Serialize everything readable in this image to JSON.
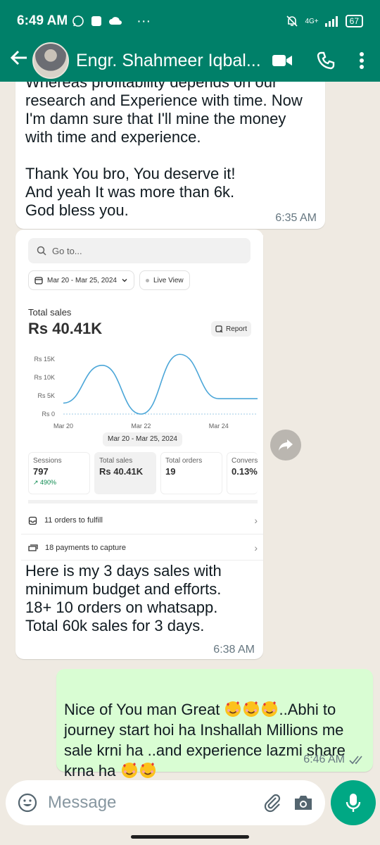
{
  "status_bar": {
    "time": "6:49 AM",
    "dots": "···",
    "network": "4G+",
    "battery": "67"
  },
  "app_bar": {
    "contact_name": "Engr. Shahmeer Iqbal...",
    "back_icon": "arrow-left-icon",
    "video_icon": "video-call-icon",
    "call_icon": "phone-icon",
    "menu_icon": "more-vert-icon"
  },
  "messages": [
    {
      "text_top_cut": "Whereas profitability depends on our",
      "text": "research and Experience with time. Now\nI'm damn sure that I'll mine the money\nwith time and experience.\n\nThank You bro, You deserve it!\nAnd yeah It was more than 6k.\nGod bless you.",
      "time": "6:35 AM"
    },
    {
      "caption": "Here is my 3 days sales with\nminimum budget and efforts.\n18+ 10 orders on whatsapp.\nTotal 60k sales for 3 days.",
      "time": "6:38 AM"
    },
    {
      "text_parts": [
        "Nice of You man Great ",
        "..Abhi to\njourney start hoi ha Inshallah Millions me\nsale krni ha ..and experience lazmi share\nkrna ha "
      ],
      "time": "6:46 AM"
    }
  ],
  "shopify_card": {
    "search_placeholder": "Go to...",
    "date_filter": "Mar 20 - Mar 25, 2024",
    "live_view": "Live View",
    "total_sales_label": "Total sales",
    "total_sales_value": "Rs 40.41K",
    "report_label": "Report",
    "date_range_chip": "Mar 20 - Mar 25, 2024",
    "metrics": [
      {
        "label": "Sessions",
        "value": "797",
        "change": "↗ 490%"
      },
      {
        "label": "Total sales",
        "value": "Rs 40.41K",
        "change": ""
      },
      {
        "label": "Total orders",
        "value": "19",
        "change": ""
      },
      {
        "label": "Convers",
        "value": "0.13%",
        "change": ""
      }
    ],
    "rows": [
      {
        "icon": "inbox-icon",
        "label": "11 orders to fulfill"
      },
      {
        "icon": "cash-icon",
        "label": "18 payments to capture"
      }
    ]
  },
  "chart_data": {
    "type": "line",
    "x": [
      "Mar 20",
      "Mar 21",
      "Mar 22",
      "Mar 23",
      "Mar 24",
      "Mar 25"
    ],
    "x_tick_labels": [
      "Mar 20",
      "Mar 22",
      "Mar 24"
    ],
    "y_tick_labels": [
      "Rs 15K",
      "Rs 10K",
      "Rs 5K",
      "Rs 0"
    ],
    "series": [
      {
        "values": [
          3000,
          13300,
          0,
          16300,
          4200,
          4200
        ]
      }
    ],
    "comparison_series_baseline": [
      0,
      0,
      0,
      0,
      0,
      0
    ],
    "ylim": [
      0,
      15000
    ],
    "color": "#4ba6d8"
  },
  "input_bar": {
    "placeholder": "Message",
    "emoji_icon": "emoji-icon",
    "attach_icon": "paperclip-icon",
    "camera_icon": "camera-icon",
    "mic_icon": "microphone-icon"
  },
  "colors": {
    "header": "#008069",
    "chat_bg": "#efeae2",
    "outgoing_bubble": "#d9fdd3",
    "mic_button": "#00a884"
  }
}
